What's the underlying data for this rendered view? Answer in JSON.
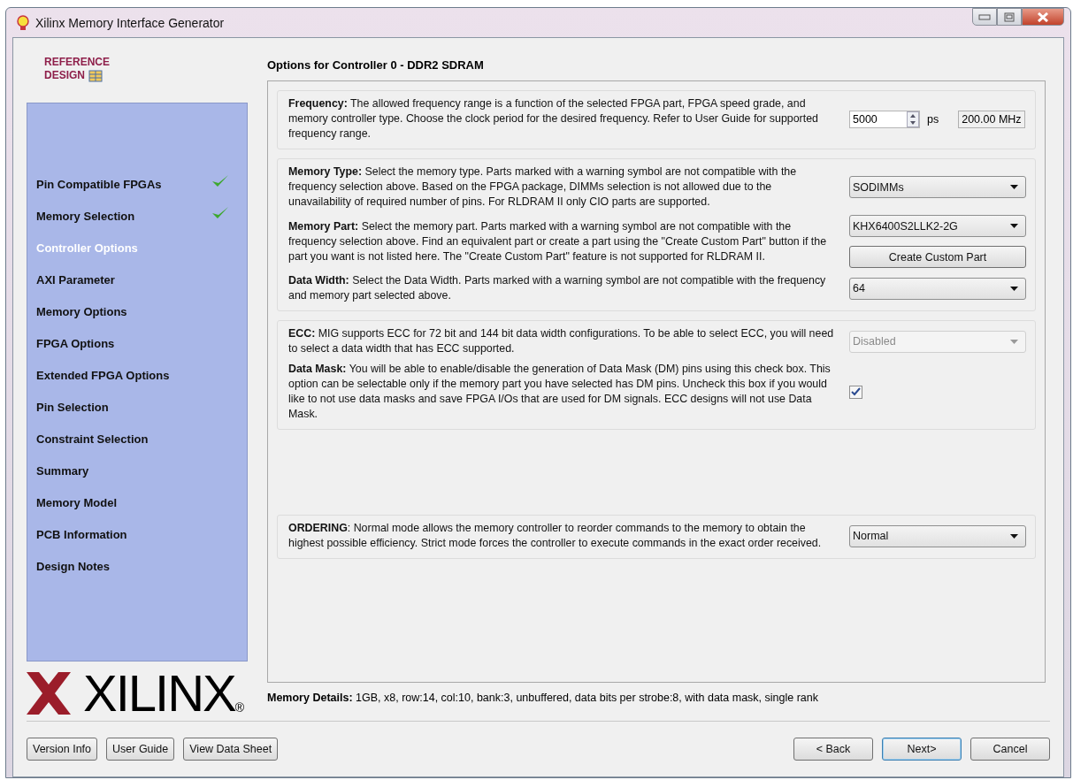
{
  "window": {
    "title": "Xilinx Memory Interface Generator"
  },
  "badge": {
    "line_1": "REFERENCE",
    "line_2": "DESIGN"
  },
  "sidebar": {
    "items": [
      {
        "label": "Pin Compatible FPGAs",
        "selected": false,
        "done": true
      },
      {
        "label": "Memory Selection",
        "selected": false,
        "done": true
      },
      {
        "label": "Controller Options",
        "selected": true,
        "done": false
      },
      {
        "label": "AXI Parameter",
        "selected": false,
        "done": false
      },
      {
        "label": "Memory Options",
        "selected": false,
        "done": false
      },
      {
        "label": "FPGA Options",
        "selected": false,
        "done": false
      },
      {
        "label": "Extended FPGA Options",
        "selected": false,
        "done": false
      },
      {
        "label": "Pin Selection",
        "selected": false,
        "done": false
      },
      {
        "label": "Constraint Selection",
        "selected": false,
        "done": false
      },
      {
        "label": "Summary",
        "selected": false,
        "done": false
      },
      {
        "label": "Memory Model",
        "selected": false,
        "done": false
      },
      {
        "label": "PCB Information",
        "selected": false,
        "done": false
      },
      {
        "label": "Design Notes",
        "selected": false,
        "done": false
      }
    ]
  },
  "logo": {
    "text": "XILINX",
    "mark": "®"
  },
  "page": {
    "title": "Options for Controller 0 - DDR2 SDRAM",
    "groups": [
      {
        "rows": [
          {
            "text": "**Frequency:** The allowed frequency range is a function of the selected FPGA part, FPGA speed grade, and memory controller type. Choose the clock period for the desired frequency. Refer to User Guide for supported frequency range.",
            "controls": [
              {
                "kind": "spin",
                "value": "5000",
                "unit": "ps",
                "readout": "200.00 MHz"
              }
            ]
          }
        ]
      },
      {
        "rows": [
          {
            "text": "**Memory Type:** Select the memory type. Parts marked with a warning symbol are not compatible with the frequency selection above. Based on the FPGA package, DIMMs selection is not allowed due to the unavailability of required number of pins. For RLDRAM II only CIO parts are supported.",
            "controls": [
              {
                "kind": "select",
                "value": "SODIMMs",
                "disabled": false
              }
            ]
          },
          {
            "text": "**Memory Part:** Select the memory part. Parts marked with a warning symbol are not compatible with the frequency selection above. Find an equivalent part or create a part using the \"Create Custom Part\" button if the part you want is not listed here. The \"Create Custom Part\" feature is not supported for RLDRAM II.",
            "controls": [
              {
                "kind": "select",
                "value": "KHX6400S2LLK2-2G",
                "disabled": false
              },
              {
                "kind": "button",
                "label": "Create Custom Part"
              }
            ]
          },
          {
            "text": "**Data Width:** Select the Data Width. Parts marked with a warning symbol are not compatible with the frequency and memory part selected above.",
            "controls": [
              {
                "kind": "select",
                "value": "64",
                "disabled": false
              }
            ]
          }
        ]
      },
      {
        "rows": [
          {
            "text": "**ECC:** MIG supports ECC for 72 bit and 144 bit data width configurations. To be able to select ECC, you will need to select a data width that has ECC supported.",
            "controls": [
              {
                "kind": "select",
                "value": "Disabled",
                "disabled": true
              }
            ]
          },
          {
            "text": "**Data Mask:** You will be able to enable/disable the generation of Data Mask (DM) pins using this check box. This option can be selectable only if the memory part you have selected has DM pins. Uncheck this box if you would like to not use data masks and save FPGA I/Os that are used for DM signals. ECC designs will not use Data Mask.",
            "controls": [
              {
                "kind": "checkbox",
                "checked": true
              }
            ]
          }
        ]
      },
      {
        "rows": [
          {
            "text": "**ORDERING**: Normal mode allows the memory controller to reorder commands to the memory to obtain the highest possible efficiency. Strict mode forces the controller to execute commands in the exact order received.",
            "controls": [
              {
                "kind": "select",
                "value": "Normal",
                "disabled": false
              }
            ]
          }
        ]
      }
    ],
    "details": "**Memory Details:** 1GB, x8, row:14, col:10, bank:3, unbuffered, data bits per strobe:8, with data mask, single rank"
  },
  "buttons_left": [
    "Version Info",
    "User Guide",
    "View Data Sheet"
  ],
  "buttons_right": [
    {
      "label": "< Back",
      "default": false
    },
    {
      "label": "Next>",
      "default": true
    },
    {
      "label": "Cancel",
      "default": false
    }
  ]
}
